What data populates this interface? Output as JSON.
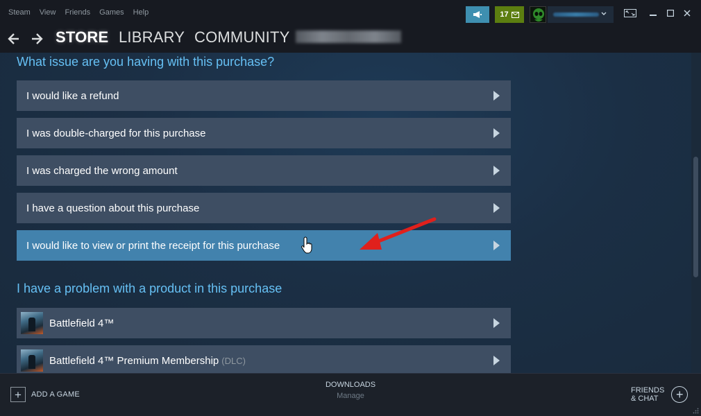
{
  "menu": [
    "Steam",
    "View",
    "Friends",
    "Games",
    "Help"
  ],
  "notifications": {
    "count": "17"
  },
  "nav": {
    "tabs": [
      "STORE",
      "LIBRARY",
      "COMMUNITY"
    ]
  },
  "purchase_issues": {
    "title": "What issue are you having with this purchase?",
    "options": [
      "I would like a refund",
      "I was double-charged for this purchase",
      "I was charged the wrong amount",
      "I have a question about this purchase",
      "I would like to view or print the receipt for this purchase"
    ]
  },
  "product_problems": {
    "title": "I have a problem with a product in this purchase",
    "items": [
      {
        "name": "Battlefield 4™",
        "tag": ""
      },
      {
        "name": "Battlefield 4™ Premium Membership",
        "tag": "(DLC)"
      }
    ]
  },
  "footer": {
    "add_game": "ADD A GAME",
    "downloads": "DOWNLOADS",
    "downloads_sub": "Manage",
    "friends_line1": "FRIENDS",
    "friends_line2": "& CHAT"
  },
  "colors": {
    "accent": "#66c0f4",
    "option_bg": "#3e4e63",
    "option_highlight": "#4282ad",
    "annotation_arrow": "#e0201c"
  }
}
